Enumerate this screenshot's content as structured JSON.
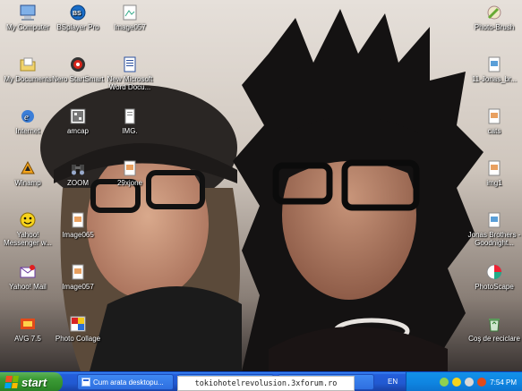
{
  "desktop": {
    "icons_left": [
      {
        "label": "My Computer",
        "icon": "my-computer-icon"
      },
      {
        "label": "My Documents",
        "icon": "my-documents-icon"
      },
      {
        "label": "Internet",
        "icon": "internet-explorer-icon"
      },
      {
        "label": "Winamp",
        "icon": "winamp-icon"
      },
      {
        "label": "Yahoo! Messenger w...",
        "icon": "yahoo-messenger-icon"
      },
      {
        "label": "Yahoo! Mail",
        "icon": "yahoo-mail-icon"
      },
      {
        "label": "AVG 7.5",
        "icon": "avg-icon"
      }
    ],
    "icons_col2": [
      {
        "label": "BSplayer Pro",
        "icon": "bsplayer-icon"
      },
      {
        "label": "Nero StartSmart",
        "icon": "nero-icon"
      },
      {
        "label": "amcap",
        "icon": "amcap-icon"
      },
      {
        "label": "ZOOM",
        "icon": "zoom-icon"
      },
      {
        "label": "Image065",
        "icon": "image-file-icon"
      },
      {
        "label": "Image057",
        "icon": "image-file-icon"
      },
      {
        "label": "Photo Collage",
        "icon": "photo-collage-icon"
      }
    ],
    "icons_col3": [
      {
        "label": "Image057",
        "icon": "image-file-icon"
      },
      {
        "label": "New Microsoft Word Docu...",
        "icon": "word-document-icon"
      },
      {
        "label": "IMG.",
        "icon": "text-file-icon"
      },
      {
        "label": "29xjone",
        "icon": "image-file-icon"
      }
    ],
    "icons_right": [
      {
        "label": "Photo-Brush",
        "icon": "photo-brush-icon"
      },
      {
        "label": "11-Jonas_br...",
        "icon": "image-file-icon"
      },
      {
        "label": "cats",
        "icon": "image-file-icon"
      },
      {
        "label": "img1",
        "icon": "image-file-icon"
      },
      {
        "label": "Jonas Brothers - Goodnight...",
        "icon": "image-file-icon"
      },
      {
        "label": "PhotoScape",
        "icon": "photoscape-icon"
      },
      {
        "label": "Coş de reciclare",
        "icon": "recycle-bin-icon"
      }
    ]
  },
  "taskbar": {
    "start_label": "start",
    "buttons": [
      {
        "label": "Cum arata desktopu..."
      },
      {
        "label": ""
      },
      {
        "label": ""
      }
    ],
    "language": "EN",
    "clock": "7:54 PM"
  },
  "watermark": "tokiohotelrevolusion.3xforum.ro",
  "colors": {
    "taskbar_blue": "#245edb",
    "start_green": "#3b9b35",
    "tray_blue": "#0f86e2"
  }
}
